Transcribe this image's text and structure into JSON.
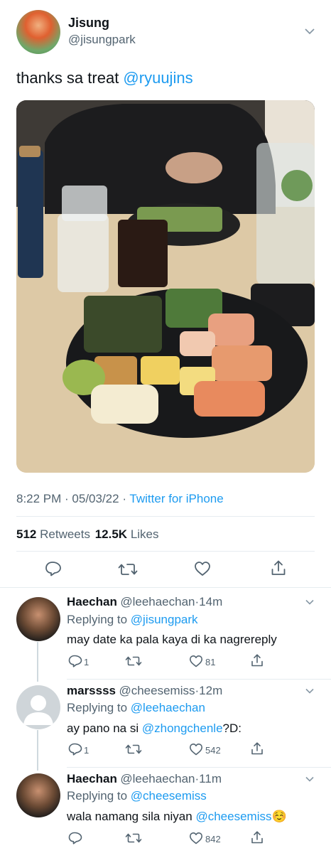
{
  "main_tweet": {
    "author_name": "Jisung",
    "author_handle": "@jisungpark",
    "text_prefix": "thanks sa treat ",
    "mention": "@ryuujins",
    "time": "8:22 PM",
    "date": "05/03/22",
    "source": "Twitter for iPhone",
    "retweets_count": "512",
    "retweets_label": "Retweets",
    "likes_count": "12.5K",
    "likes_label": "Likes"
  },
  "replies": [
    {
      "name": "Haechan",
      "handle": "@leehaechan",
      "time": "14m",
      "replying_to_label": "Replying to ",
      "replying_to": "@jisungpark",
      "text": "may date ka pala kaya di ka nagrereply",
      "reply_count": "1",
      "like_count": "81"
    },
    {
      "name": "marssss",
      "handle": "@cheesemiss",
      "time": "12m",
      "replying_to_label": "Replying to ",
      "replying_to": "@leehaechan",
      "text_prefix": "ay pano na si ",
      "mention": "@zhongchenle",
      "text_suffix": "?D:",
      "reply_count": "1",
      "like_count": "542"
    },
    {
      "name": "Haechan",
      "handle": "@leehaechan",
      "time": "11m",
      "replying_to_label": "Replying to ",
      "replying_to": "@cheesemiss",
      "text_prefix": "wala namang sila niyan ",
      "mention": "@cheesemiss",
      "emoji": "☺️",
      "like_count": "842"
    }
  ],
  "colors": {
    "link": "#1d9bf0",
    "muted": "#536471",
    "divider": "#e6ecf0"
  }
}
